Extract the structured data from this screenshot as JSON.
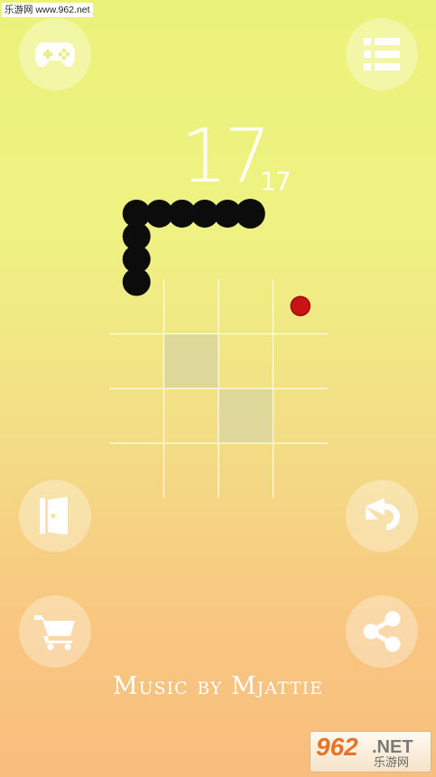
{
  "watermark": {
    "top_text": "乐游网 www.962.net",
    "bottom_number": "962",
    "bottom_domain": ".NET",
    "bottom_name": "乐游网"
  },
  "score": {
    "current": "17",
    "best": "17"
  },
  "footer": {
    "music_credit": "Music by Mjattie"
  },
  "buttons": {
    "games": "gamepad-icon",
    "menu": "list-icon",
    "exit": "door-icon",
    "undo": "undo-icon",
    "shop": "cart-icon",
    "share": "share-icon"
  },
  "game": {
    "grid_columns": 4,
    "grid_rows": 4,
    "snake": [
      [
        0,
        -1
      ],
      [
        0,
        -2
      ],
      [
        0,
        -3
      ],
      [
        0,
        -4
      ],
      [
        1,
        -4
      ],
      [
        2,
        -4
      ],
      [
        3,
        -4
      ],
      [
        4,
        -4
      ],
      [
        5,
        -4
      ]
    ],
    "food": [
      3,
      0
    ],
    "shaded_cells": [
      [
        1,
        1
      ],
      [
        2,
        2
      ]
    ],
    "colors": {
      "snake": "#0c0c0c",
      "food": "#c81414",
      "shaded_cell": "#d9d59e",
      "grid_line": "#ffffff"
    }
  }
}
